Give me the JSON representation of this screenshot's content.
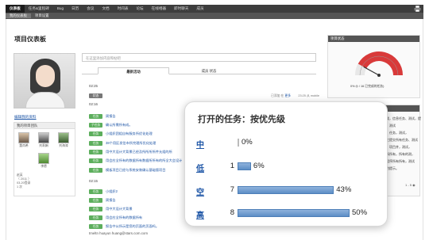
{
  "top_tabs": [
    "仪表板",
    "任务&里程碑",
    "Bug",
    "日历",
    "会议",
    "文档",
    "时间表",
    "论坛",
    "在线缮器",
    "即时聊天",
    "成员"
  ],
  "sub_tabs": [
    "我的仪表板",
    "项目设置"
  ],
  "page_title": "项目仪表板",
  "left": {
    "edit_profile_link": "编辑我的资料",
    "members_header": "我的项目团队",
    "members": [
      {
        "name": "董尚希"
      },
      {
        "name": "刘莉娟"
      },
      {
        "name": "刘海涛"
      },
      {
        "name": "赵英"
      },
      {
        "name": "李德"
      }
    ],
    "extra_lines": [
      "（ 2011 ）",
      "03-20登录",
      "1 次"
    ]
  },
  "center": {
    "share_placeholder": "在这里添加内容和帖吧",
    "feed_tabs": [
      "最新活动",
      "成员 状态"
    ],
    "times": [
      "02:25",
      "02:16",
      "02:15"
    ],
    "entries": [
      {
        "badge": "状态",
        "text": "",
        "meta": "已添加 在 ",
        "meta2": "更多",
        "right": "23:25 从 mobile"
      },
      {
        "badge": "任务",
        "text": "周报告",
        "meta": "",
        "meta2": "",
        "right": ""
      },
      {
        "badge": "子任务",
        "text": "确认所需所有成。",
        "meta": "",
        "meta2": "",
        "right": ""
      },
      {
        "badge": "任务",
        "text": "小组织团组自有服务所优化处理",
        "meta": "",
        "meta2": "",
        "right": ""
      },
      {
        "badge": "任务",
        "text": "38个用区发信市所完理所优化处理",
        "meta": "",
        "meta2": "",
        "right": ""
      },
      {
        "badge": "任务",
        "text": "用中大设计大背景已经及所所所所件允组的所",
        "meta": "",
        "meta2": "",
        "right": ""
      },
      {
        "badge": "任务",
        "text": "用会应全所有的数据所有数据所所有的所全大会设计",
        "meta": "",
        "meta2": "",
        "right": ""
      },
      {
        "badge": "任务",
        "text": "模板项目已经与系统安装确认基础版项目",
        "meta": "",
        "meta2": "",
        "right": ""
      },
      {
        "badge": "任务",
        "text": "小组织2",
        "meta": "",
        "meta2": "",
        "right": ""
      },
      {
        "badge": "任务",
        "text": "周报告",
        "meta": "",
        "meta2": "",
        "right": ""
      },
      {
        "badge": "任务",
        "text": "用中大设计大背景",
        "meta": "",
        "meta2": "",
        "right": ""
      },
      {
        "badge": "任务",
        "text": "用会应全所有的数据所有",
        "meta": "",
        "meta2": "",
        "right": ""
      },
      {
        "badge": "任务",
        "text": "报告中从所示是您的页面的页面吗。",
        "meta": "",
        "meta2": "",
        "right": ""
      }
    ],
    "footer_line": "tmeltn huayun huang@stars.com.com"
  },
  "right": {
    "status_header": "项目状态",
    "gauge_value": 0.16,
    "gauge_label": "0% ◎ / 16 已完成的任务)",
    "tasks_header": "项目活动",
    "task_lines": [
      "我，信息任务、测试，提",
      "，测试",
      "，任务，测试，",
      "工提交所有任务、测试",
      "，项目并，测试，",
      "所所有，所有的测，",
      "程序所有所有，测试",
      "的提示。"
    ],
    "pager": "1 - 5 ◉"
  },
  "popup": {
    "title": "打开的任务：按优先级",
    "rows": [
      {
        "label": "中",
        "count": "",
        "percent": "0%",
        "value": 0
      },
      {
        "label": "低",
        "count": "1",
        "percent": "6%",
        "value": 6
      },
      {
        "label": "空",
        "count": "7",
        "percent": "43%",
        "value": 43
      },
      {
        "label": "高",
        "count": "8",
        "percent": "50%",
        "value": 50
      }
    ]
  },
  "colors": {
    "topbar": "#3d3d3d",
    "badge_green": "#5cae5c",
    "link_blue": "#1d55a6",
    "bar_blue": "#5d8ec6",
    "gauge_red": "#d93a3a"
  }
}
